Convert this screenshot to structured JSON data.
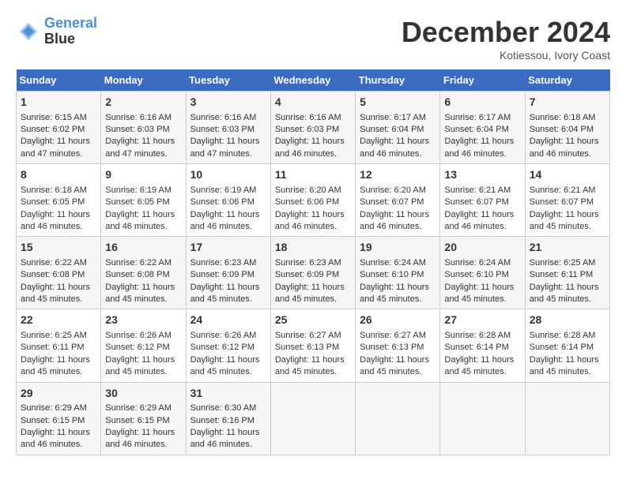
{
  "header": {
    "logo_line1": "General",
    "logo_line2": "Blue",
    "month": "December 2024",
    "location": "Kotiessou, Ivory Coast"
  },
  "days_of_week": [
    "Sunday",
    "Monday",
    "Tuesday",
    "Wednesday",
    "Thursday",
    "Friday",
    "Saturday"
  ],
  "weeks": [
    [
      {
        "day": "1",
        "sunrise": "6:15 AM",
        "sunset": "6:02 PM",
        "daylight": "11 hours and 47 minutes."
      },
      {
        "day": "2",
        "sunrise": "6:16 AM",
        "sunset": "6:03 PM",
        "daylight": "11 hours and 47 minutes."
      },
      {
        "day": "3",
        "sunrise": "6:16 AM",
        "sunset": "6:03 PM",
        "daylight": "11 hours and 47 minutes."
      },
      {
        "day": "4",
        "sunrise": "6:16 AM",
        "sunset": "6:03 PM",
        "daylight": "11 hours and 46 minutes."
      },
      {
        "day": "5",
        "sunrise": "6:17 AM",
        "sunset": "6:04 PM",
        "daylight": "11 hours and 46 minutes."
      },
      {
        "day": "6",
        "sunrise": "6:17 AM",
        "sunset": "6:04 PM",
        "daylight": "11 hours and 46 minutes."
      },
      {
        "day": "7",
        "sunrise": "6:18 AM",
        "sunset": "6:04 PM",
        "daylight": "11 hours and 46 minutes."
      }
    ],
    [
      {
        "day": "8",
        "sunrise": "6:18 AM",
        "sunset": "6:05 PM",
        "daylight": "11 hours and 46 minutes."
      },
      {
        "day": "9",
        "sunrise": "6:19 AM",
        "sunset": "6:05 PM",
        "daylight": "11 hours and 46 minutes."
      },
      {
        "day": "10",
        "sunrise": "6:19 AM",
        "sunset": "6:06 PM",
        "daylight": "11 hours and 46 minutes."
      },
      {
        "day": "11",
        "sunrise": "6:20 AM",
        "sunset": "6:06 PM",
        "daylight": "11 hours and 46 minutes."
      },
      {
        "day": "12",
        "sunrise": "6:20 AM",
        "sunset": "6:07 PM",
        "daylight": "11 hours and 46 minutes."
      },
      {
        "day": "13",
        "sunrise": "6:21 AM",
        "sunset": "6:07 PM",
        "daylight": "11 hours and 46 minutes."
      },
      {
        "day": "14",
        "sunrise": "6:21 AM",
        "sunset": "6:07 PM",
        "daylight": "11 hours and 45 minutes."
      }
    ],
    [
      {
        "day": "15",
        "sunrise": "6:22 AM",
        "sunset": "6:08 PM",
        "daylight": "11 hours and 45 minutes."
      },
      {
        "day": "16",
        "sunrise": "6:22 AM",
        "sunset": "6:08 PM",
        "daylight": "11 hours and 45 minutes."
      },
      {
        "day": "17",
        "sunrise": "6:23 AM",
        "sunset": "6:09 PM",
        "daylight": "11 hours and 45 minutes."
      },
      {
        "day": "18",
        "sunrise": "6:23 AM",
        "sunset": "6:09 PM",
        "daylight": "11 hours and 45 minutes."
      },
      {
        "day": "19",
        "sunrise": "6:24 AM",
        "sunset": "6:10 PM",
        "daylight": "11 hours and 45 minutes."
      },
      {
        "day": "20",
        "sunrise": "6:24 AM",
        "sunset": "6:10 PM",
        "daylight": "11 hours and 45 minutes."
      },
      {
        "day": "21",
        "sunrise": "6:25 AM",
        "sunset": "6:11 PM",
        "daylight": "11 hours and 45 minutes."
      }
    ],
    [
      {
        "day": "22",
        "sunrise": "6:25 AM",
        "sunset": "6:11 PM",
        "daylight": "11 hours and 45 minutes."
      },
      {
        "day": "23",
        "sunrise": "6:26 AM",
        "sunset": "6:12 PM",
        "daylight": "11 hours and 45 minutes."
      },
      {
        "day": "24",
        "sunrise": "6:26 AM",
        "sunset": "6:12 PM",
        "daylight": "11 hours and 45 minutes."
      },
      {
        "day": "25",
        "sunrise": "6:27 AM",
        "sunset": "6:13 PM",
        "daylight": "11 hours and 45 minutes."
      },
      {
        "day": "26",
        "sunrise": "6:27 AM",
        "sunset": "6:13 PM",
        "daylight": "11 hours and 45 minutes."
      },
      {
        "day": "27",
        "sunrise": "6:28 AM",
        "sunset": "6:14 PM",
        "daylight": "11 hours and 45 minutes."
      },
      {
        "day": "28",
        "sunrise": "6:28 AM",
        "sunset": "6:14 PM",
        "daylight": "11 hours and 45 minutes."
      }
    ],
    [
      {
        "day": "29",
        "sunrise": "6:29 AM",
        "sunset": "6:15 PM",
        "daylight": "11 hours and 46 minutes."
      },
      {
        "day": "30",
        "sunrise": "6:29 AM",
        "sunset": "6:15 PM",
        "daylight": "11 hours and 46 minutes."
      },
      {
        "day": "31",
        "sunrise": "6:30 AM",
        "sunset": "6:16 PM",
        "daylight": "11 hours and 46 minutes."
      },
      null,
      null,
      null,
      null
    ]
  ]
}
